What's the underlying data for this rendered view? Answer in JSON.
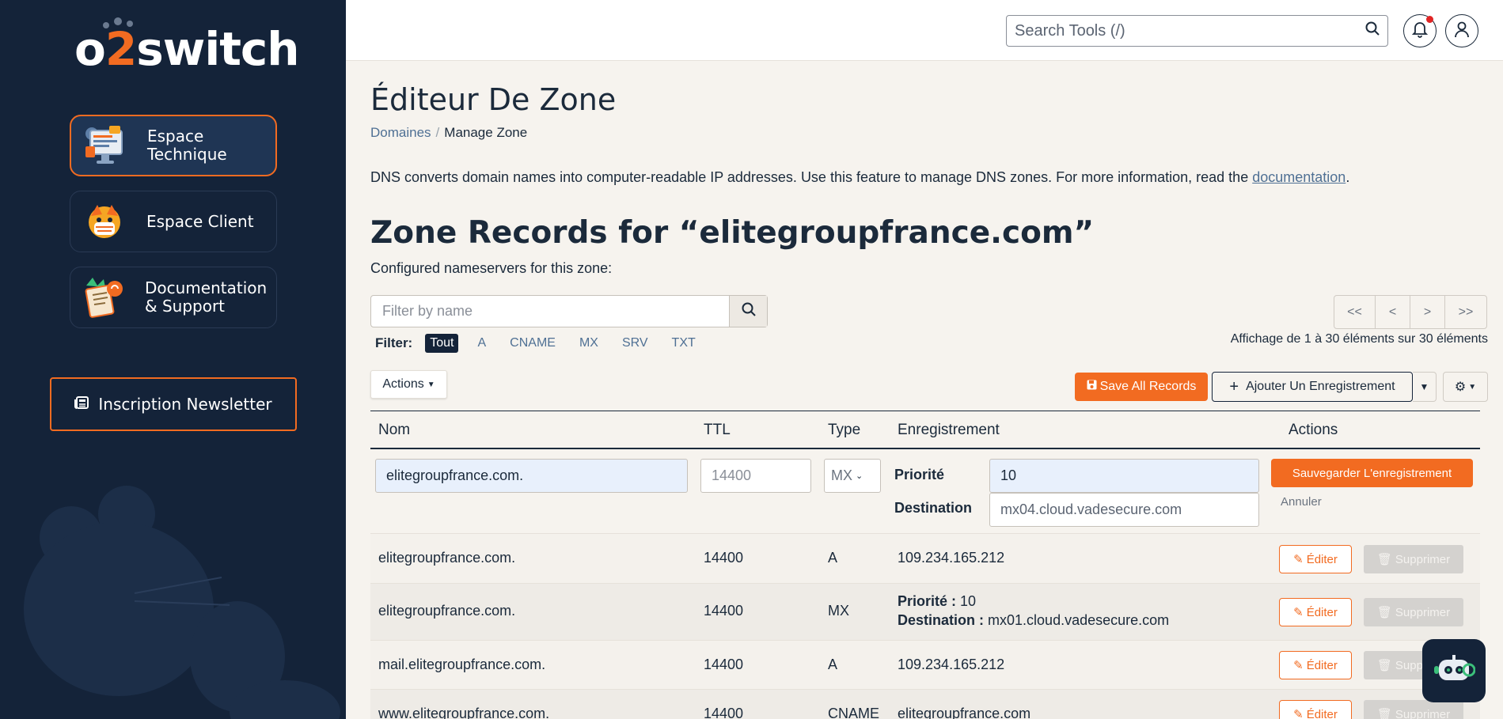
{
  "sidebar": {
    "logo": {
      "pre": "o",
      "num": "2",
      "post": "switch"
    },
    "cards": [
      {
        "label_line1": "Espace",
        "label_line2": "Technique"
      },
      {
        "label_line1": "Espace Client",
        "label_line2": ""
      },
      {
        "label_line1": "Documentation",
        "label_line2": "& Support"
      }
    ],
    "newsletter_label": "Inscription Newsletter"
  },
  "topbar": {
    "search_placeholder": "Search Tools (/)"
  },
  "page": {
    "title": "Éditeur De Zone",
    "breadcrumb": {
      "parent": "Domaines",
      "sep": "/",
      "current": "Manage Zone"
    },
    "description": "DNS converts domain names into computer-readable IP addresses. Use this feature to manage DNS zones. For more information, read the ",
    "description_link": "documentation",
    "description_end": ".",
    "zone_title": "Zone Records for “elitegroupfrance.com”",
    "nameservers_label": "Configured nameservers for this zone:"
  },
  "toolbar": {
    "filter_placeholder": "Filter by name",
    "filter_label": "Filter:",
    "filter_chips": [
      "Tout",
      "A",
      "CNAME",
      "MX",
      "SRV",
      "TXT"
    ],
    "pager": [
      "<<",
      "<",
      ">",
      ">>"
    ],
    "pager_info": "Affichage de 1 à 30 éléments sur 30 éléments",
    "actions_label": "Actions",
    "save_all_label": "Save All Records",
    "add_record_label": "Ajouter Un Enregistrement"
  },
  "table": {
    "headers": {
      "name": "Nom",
      "ttl": "TTL",
      "type": "Type",
      "record": "Enregistrement",
      "actions": "Actions"
    },
    "edit_row": {
      "name": "elitegroupfrance.com.",
      "ttl_placeholder": "14400",
      "type": "MX",
      "priority_label": "Priorité",
      "priority": "10",
      "destination_label": "Destination",
      "destination": "mx04.cloud.vadesecure.com",
      "save_label": "Sauvegarder L'enregistrement",
      "cancel_label": "Annuler"
    },
    "rows": [
      {
        "name": "elitegroupfrance.com.",
        "ttl": "14400",
        "type": "A",
        "record": "109.234.165.212"
      },
      {
        "name": "elitegroupfrance.com.",
        "ttl": "14400",
        "type": "MX",
        "priority_label": "Priorité :",
        "priority": "10",
        "destination_label": "Destination :",
        "destination": "mx01.cloud.vadesecure.com"
      },
      {
        "name": "mail.elitegroupfrance.com.",
        "ttl": "14400",
        "type": "A",
        "record": "109.234.165.212"
      },
      {
        "name": "www.elitegroupfrance.com.",
        "ttl": "14400",
        "type": "CNAME",
        "record": "elitegroupfrance.com"
      }
    ],
    "edit_label": "Éditer",
    "delete_label": "Supprimer"
  },
  "colors": {
    "accent": "#f26b21",
    "navy": "#142339",
    "link": "#4f7094"
  },
  "icons": [
    "search-icon",
    "bell-icon",
    "user-icon",
    "newspaper-icon",
    "save-icon",
    "plus-icon",
    "gear-icon",
    "pencil-icon",
    "trash-icon",
    "robot-icon"
  ]
}
